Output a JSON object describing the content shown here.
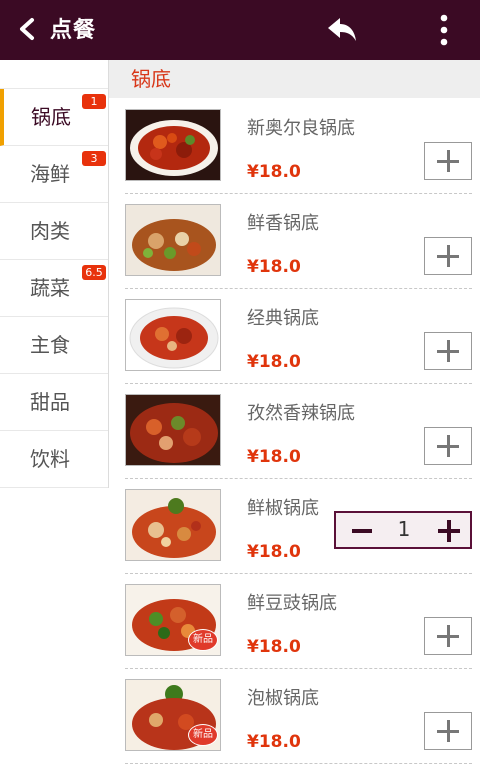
{
  "header": {
    "back_icon": "chevron-left-icon",
    "title": "点餐",
    "undo_icon": "reply-arrow-icon",
    "menu_icon": "more-vertical-icon",
    "bg_color": "#3b0a24"
  },
  "sidebar": {
    "items": [
      {
        "label": "锅底",
        "badge": "1",
        "active": true
      },
      {
        "label": "海鲜",
        "badge": "3"
      },
      {
        "label": "肉类",
        "badge": ""
      },
      {
        "label": "蔬菜",
        "badge": "6.5"
      },
      {
        "label": "主食",
        "badge": ""
      },
      {
        "label": "甜品",
        "badge": ""
      },
      {
        "label": "饮料",
        "badge": ""
      }
    ],
    "active_color": "#f0a000",
    "badge_color": "#e8320c"
  },
  "section": {
    "title": "锅底"
  },
  "dishes": [
    {
      "name": "新奥尔良锅底",
      "price": "¥18.0",
      "qty": 0
    },
    {
      "name": "鲜香锅底",
      "price": "¥18.0",
      "qty": 0
    },
    {
      "name": "经典锅底",
      "price": "¥18.0",
      "qty": 0
    },
    {
      "name": "孜然香辣锅底",
      "price": "¥18.0",
      "qty": 0
    },
    {
      "name": "鲜椒锅底",
      "price": "¥18.0",
      "qty": "1"
    },
    {
      "name": "鲜豆豉锅底",
      "price": "¥18.0",
      "qty": 0,
      "tag": "新品"
    },
    {
      "name": "泡椒锅底",
      "price": "¥18.0",
      "qty": 0,
      "tag": "新品"
    }
  ],
  "price_color": "#e0350c"
}
